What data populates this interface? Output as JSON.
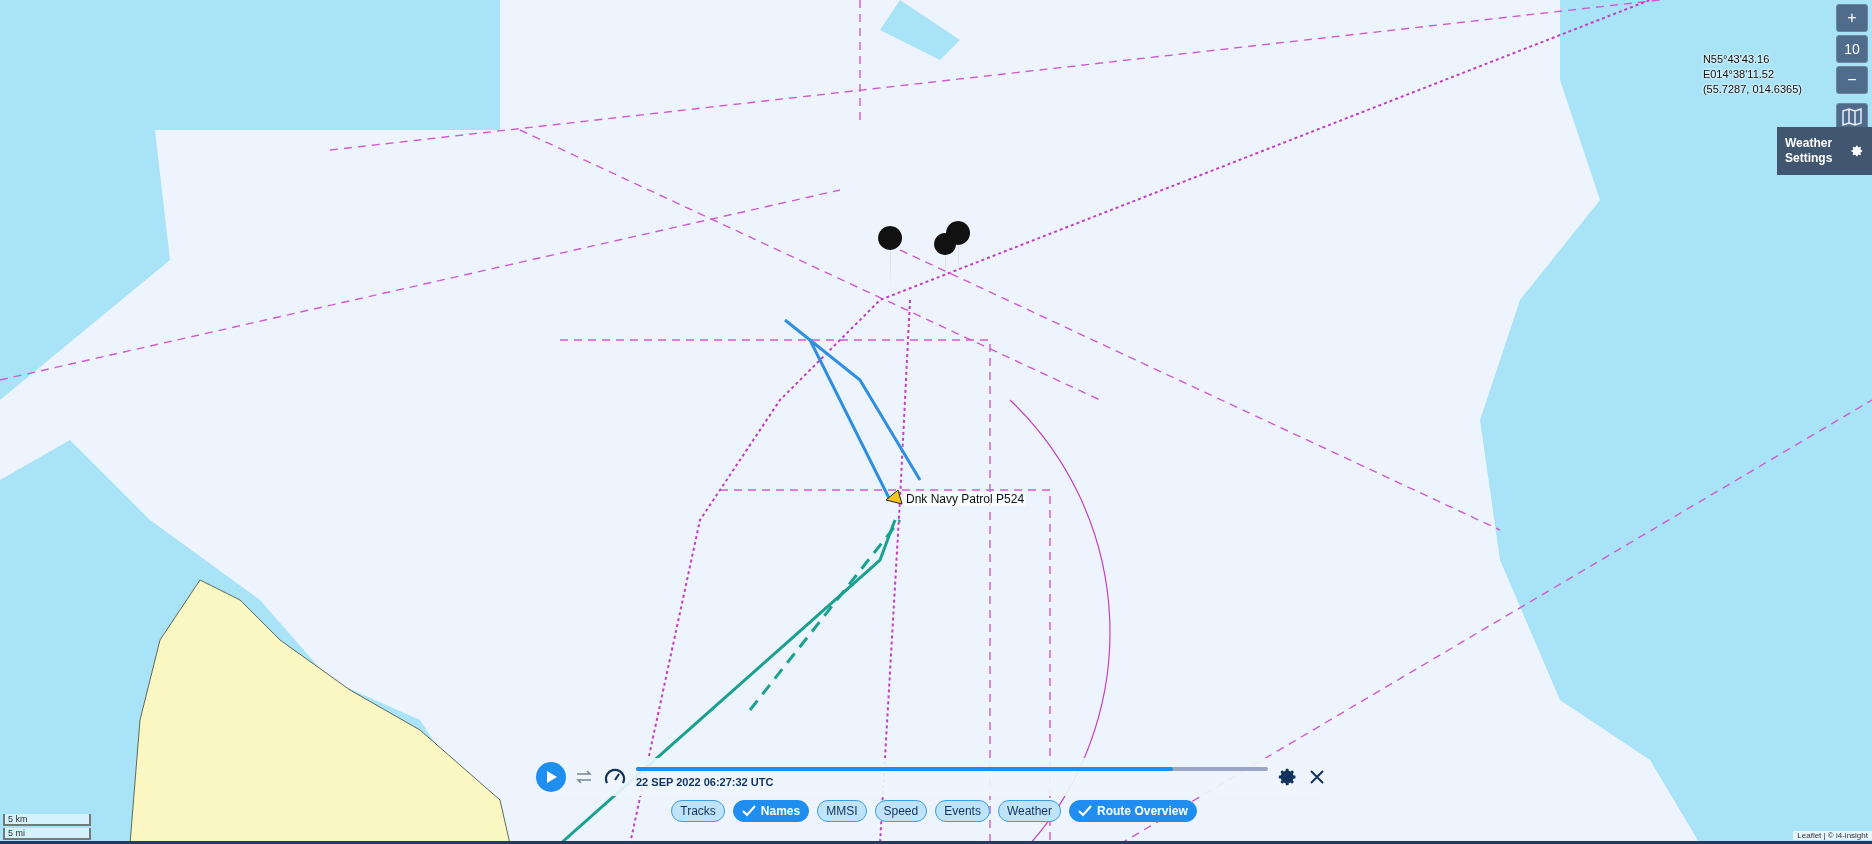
{
  "map": {
    "zoom_in": "+",
    "zoom_level": "10",
    "zoom_out": "−"
  },
  "cursor_position": [
    "N55°43'43.16",
    "E014°38'11.52",
    "(55.7287, 014.6365)"
  ],
  "weather_settings": {
    "label": "Weather Settings"
  },
  "vessel": {
    "name": "Dnk Navy Patrol P524"
  },
  "playback": {
    "timestamp": "22 SEP 2022 06:27:32 UTC",
    "level": 0.85,
    "playing": false
  },
  "toggles": [
    {
      "label": "Tracks",
      "selected": false
    },
    {
      "label": "Names",
      "selected": true
    },
    {
      "label": "MMSI",
      "selected": false
    },
    {
      "label": "Speed",
      "selected": false
    },
    {
      "label": "Events",
      "selected": false
    },
    {
      "label": "Weather",
      "selected": false
    },
    {
      "label": "Route Overview",
      "selected": true
    }
  ],
  "scale": [
    "5 km",
    "5 mi"
  ],
  "attribution": "Leaflet | © i4-insight"
}
